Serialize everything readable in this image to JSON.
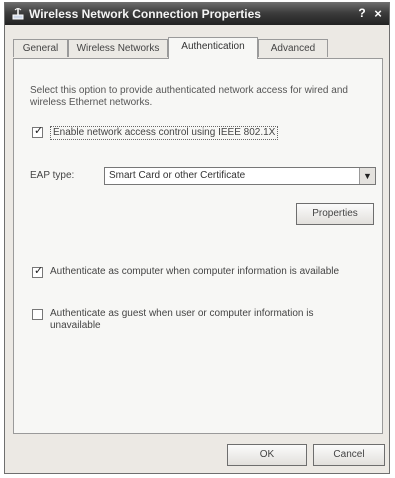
{
  "window": {
    "title": "Wireless Network Connection Properties",
    "help_glyph": "?",
    "close_glyph": "×"
  },
  "tabs": [
    {
      "label": "General"
    },
    {
      "label": "Wireless Networks"
    },
    {
      "label": "Authentication",
      "active": true
    },
    {
      "label": "Advanced"
    }
  ],
  "auth": {
    "description": "Select this option to provide authenticated network access for wired and wireless Ethernet networks.",
    "enable_8021x_label": "Enable network access control using IEEE 802.1X",
    "enable_8021x_checked": true,
    "eap_label": "EAP type:",
    "eap_value": "Smart Card or other Certificate",
    "properties_label": "Properties",
    "auth_computer_label": "Authenticate as computer when computer information is available",
    "auth_computer_checked": true,
    "auth_guest_label": "Authenticate as guest when user or computer information is unavailable",
    "auth_guest_checked": false
  },
  "footer": {
    "ok_label": "OK",
    "cancel_label": "Cancel"
  }
}
